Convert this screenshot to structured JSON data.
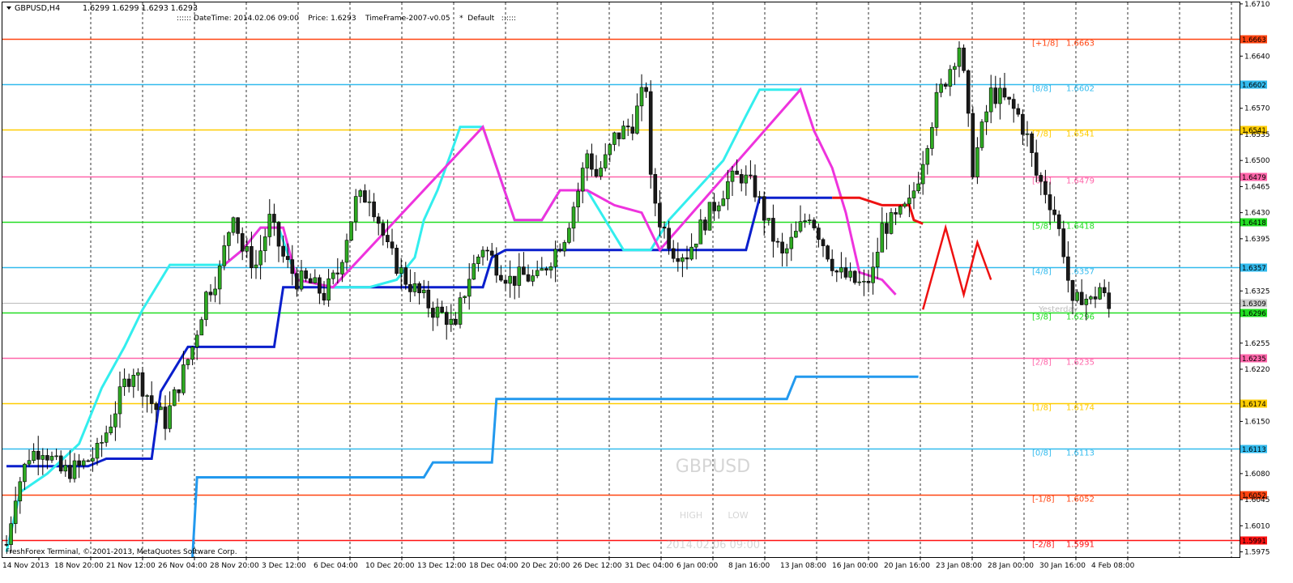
{
  "window": {
    "symbol_tf": "GBPUSD,H4",
    "ohlc": "1.6299 1.6299 1.6293 1.6293"
  },
  "info_bar": ":::::: DateTime: 2014.02.06 09:00    Price: 1.6293    TimeFrame-2007-v0.05    *  Default   ::::::",
  "copyright": "FreshForex Terminal, © 2001-2013, MetaQuotes Software Corp.",
  "watermark": {
    "symbol": "GBPUSD",
    "high_label": "HIGH",
    "low_label": "LOW",
    "datetime": "2014.02.06 09:00"
  },
  "yesterday_label": "Yesterday",
  "colors": {
    "bull": "#2eaa22",
    "bear": "#1a1a1a",
    "cyan_line": "#33eeee",
    "magenta_line": "#ee33dd",
    "darkblue_line": "#0a1fcc",
    "lightblue_line": "#2299ee",
    "red_line": "#ee1111",
    "grid": "#333333"
  },
  "y_axis": {
    "min": 1.5968,
    "max": 1.6712,
    "ticks": [
      "1.6710",
      "1.6640",
      "1.6570",
      "1.6535",
      "1.6500",
      "1.6465",
      "1.6430",
      "1.6395",
      "1.6325",
      "1.6255",
      "1.6220",
      "1.6150",
      "1.6080",
      "1.6045",
      "1.6010",
      "1.5975"
    ]
  },
  "x_axis": {
    "labels": [
      "14 Nov 2013",
      "18 Nov 20:00",
      "21 Nov 12:00",
      "26 Nov 04:00",
      "28 Nov 20:00",
      "3 Dec 12:00",
      "6 Dec 04:00",
      "10 Dec 20:00",
      "13 Dec 12:00",
      "18 Dec 04:00",
      "20 Dec 20:00",
      "26 Dec 12:00",
      "31 Dec 04:00",
      "6 Jan 00:00",
      "8 Jan 16:00",
      "13 Jan 08:00",
      "16 Jan 00:00",
      "20 Jan 16:00",
      "23 Jan 08:00",
      "28 Jan 00:00",
      "30 Jan 16:00",
      "4 Feb 08:00"
    ]
  },
  "murrey_levels": [
    {
      "label": "[+1/8]",
      "value": "1.6663",
      "color": "#ff4411"
    },
    {
      "label": "[8/8]",
      "value": "1.6602",
      "color": "#33bbee"
    },
    {
      "label": "[7/8]",
      "value": "1.6541",
      "color": "#ffcc00"
    },
    {
      "label": "[6/8]",
      "value": "1.6479",
      "color": "#ff66aa"
    },
    {
      "label": "[5/8]",
      "value": "1.6418",
      "color": "#22dd22"
    },
    {
      "label": "[4/8]",
      "value": "1.6357",
      "color": "#33bbee"
    },
    {
      "label": "[3/8]",
      "value": "1.6296",
      "color": "#22dd22"
    },
    {
      "label": "[2/8]",
      "value": "1.6235",
      "color": "#ff66aa"
    },
    {
      "label": "[1/8]",
      "value": "1.6174",
      "color": "#ffcc00"
    },
    {
      "label": "[0/8]",
      "value": "1.6113",
      "color": "#33bbee"
    },
    {
      "label": "[-1/8]",
      "value": "1.6052",
      "color": "#ff4411"
    },
    {
      "label": "[-2/8]",
      "value": "1.5991",
      "color": "#ff1111"
    }
  ],
  "current_price_badge": {
    "value": "1.6309",
    "color": "#cccccc"
  },
  "chart_data": {
    "type": "candlestick",
    "symbol": "GBPUSD",
    "timeframe": "H4",
    "anchors": [
      [
        0,
        1.5985
      ],
      [
        2,
        1.6055
      ],
      [
        5,
        1.6105
      ],
      [
        8,
        1.6115
      ],
      [
        12,
        1.6082
      ],
      [
        16,
        1.6088
      ],
      [
        20,
        1.6108
      ],
      [
        23,
        1.615
      ],
      [
        26,
        1.62
      ],
      [
        28,
        1.622
      ],
      [
        32,
        1.6175
      ],
      [
        35,
        1.615
      ],
      [
        38,
        1.62
      ],
      [
        41,
        1.625
      ],
      [
        44,
        1.632
      ],
      [
        47,
        1.6352
      ],
      [
        50,
        1.6435
      ],
      [
        52,
        1.638
      ],
      [
        55,
        1.636
      ],
      [
        58,
        1.642
      ],
      [
        61,
        1.637
      ],
      [
        64,
        1.634
      ],
      [
        67,
        1.6335
      ],
      [
        70,
        1.632
      ],
      [
        73,
        1.635
      ],
      [
        75,
        1.64
      ],
      [
        77,
        1.6445
      ],
      [
        80,
        1.6455
      ],
      [
        82,
        1.642
      ],
      [
        84,
        1.638
      ],
      [
        88,
        1.634
      ],
      [
        91,
        1.632
      ],
      [
        94,
        1.63
      ],
      [
        97,
        1.629
      ],
      [
        99,
        1.627
      ],
      [
        100,
        1.6305
      ],
      [
        102,
        1.6345
      ],
      [
        105,
        1.6385
      ],
      [
        108,
        1.636
      ],
      [
        111,
        1.634
      ],
      [
        114,
        1.6345
      ],
      [
        117,
        1.634
      ],
      [
        120,
        1.637
      ],
      [
        123,
        1.64
      ],
      [
        126,
        1.646
      ],
      [
        128,
        1.651
      ],
      [
        130,
        1.648
      ],
      [
        132,
        1.65
      ],
      [
        134,
        1.653
      ],
      [
        136,
        1.654
      ],
      [
        138,
        1.655
      ],
      [
        140,
        1.6585
      ],
      [
        141,
        1.66
      ],
      [
        142,
        1.647
      ],
      [
        144,
        1.642
      ],
      [
        147,
        1.638
      ],
      [
        150,
        1.6375
      ],
      [
        153,
        1.641
      ],
      [
        156,
        1.644
      ],
      [
        159,
        1.647
      ],
      [
        162,
        1.648
      ],
      [
        165,
        1.646
      ],
      [
        168,
        1.641
      ],
      [
        171,
        1.637
      ],
      [
        174,
        1.64
      ],
      [
        177,
        1.643
      ],
      [
        180,
        1.639
      ],
      [
        183,
        1.635
      ],
      [
        186,
        1.634
      ],
      [
        189,
        1.633
      ],
      [
        191,
        1.635
      ],
      [
        193,
        1.641
      ],
      [
        196,
        1.642
      ],
      [
        199,
        1.644
      ],
      [
        201,
        1.648
      ],
      [
        203,
        1.653
      ],
      [
        205,
        1.658
      ],
      [
        207,
        1.661
      ],
      [
        209,
        1.664
      ],
      [
        210,
        1.6655
      ],
      [
        211,
        1.661
      ],
      [
        213,
        1.649
      ],
      [
        215,
        1.654
      ],
      [
        217,
        1.659
      ],
      [
        219,
        1.6585
      ],
      [
        221,
        1.6575
      ],
      [
        223,
        1.656
      ],
      [
        225,
        1.653
      ],
      [
        227,
        1.648
      ],
      [
        229,
        1.646
      ],
      [
        231,
        1.643
      ],
      [
        233,
        1.638
      ],
      [
        235,
        1.63
      ],
      [
        237,
        1.632
      ],
      [
        239,
        1.631
      ],
      [
        241,
        1.633
      ],
      [
        243,
        1.63
      ],
      [
        244,
        1.6295
      ]
    ],
    "n_candles": 245,
    "cyan_line": [
      [
        0,
        1.5975
      ],
      [
        3,
        1.6055
      ],
      [
        9,
        1.608
      ],
      [
        16,
        1.612
      ],
      [
        21,
        1.6195
      ],
      [
        26,
        1.625
      ],
      [
        30,
        1.63
      ],
      [
        36,
        1.636
      ],
      [
        48,
        1.636
      ],
      [
        52,
        1.638
      ],
      [
        56,
        1.641
      ],
      [
        60,
        1.641
      ],
      [
        64,
        1.634
      ],
      [
        72,
        1.633
      ],
      [
        80,
        1.633
      ],
      [
        86,
        1.634
      ],
      [
        90,
        1.637
      ],
      [
        92,
        1.642
      ],
      [
        95,
        1.646
      ],
      [
        98,
        1.651
      ],
      [
        100,
        1.6545
      ],
      [
        105,
        1.6545
      ],
      [
        112,
        1.642
      ],
      [
        118,
        1.642
      ],
      [
        122,
        1.646
      ],
      [
        128,
        1.646
      ],
      [
        136,
        1.638
      ],
      [
        142,
        1.638
      ],
      [
        146,
        1.642
      ],
      [
        152,
        1.646
      ],
      [
        158,
        1.65
      ],
      [
        163,
        1.656
      ],
      [
        166,
        1.6595
      ],
      [
        175,
        1.6595
      ]
    ],
    "magenta_line": [
      [
        48,
        1.636
      ],
      [
        52,
        1.638
      ],
      [
        56,
        1.641
      ],
      [
        61,
        1.641
      ],
      [
        64,
        1.634
      ],
      [
        72,
        1.633
      ],
      [
        105,
        1.6545
      ],
      [
        112,
        1.642
      ],
      [
        118,
        1.642
      ],
      [
        122,
        1.646
      ],
      [
        128,
        1.646
      ],
      [
        134,
        1.644
      ],
      [
        140,
        1.643
      ],
      [
        144,
        1.638
      ],
      [
        175,
        1.6595
      ],
      [
        178,
        1.654
      ],
      [
        182,
        1.649
      ],
      [
        185,
        1.643
      ],
      [
        188,
        1.635
      ],
      [
        193,
        1.634
      ],
      [
        196,
        1.632
      ]
    ],
    "darkblue_line": [
      [
        0,
        1.609
      ],
      [
        18,
        1.609
      ],
      [
        22,
        1.61
      ],
      [
        32,
        1.61
      ],
      [
        34,
        1.619
      ],
      [
        38,
        1.623
      ],
      [
        40,
        1.625
      ],
      [
        59,
        1.625
      ],
      [
        61,
        1.633
      ],
      [
        105,
        1.633
      ],
      [
        107,
        1.637
      ],
      [
        110,
        1.638
      ],
      [
        163,
        1.638
      ],
      [
        166,
        1.645
      ],
      [
        182,
        1.645
      ]
    ],
    "lightblue_line": [
      [
        41,
        1.5968
      ],
      [
        42,
        1.6075
      ],
      [
        92,
        1.6075
      ],
      [
        94,
        1.6095
      ],
      [
        107,
        1.6095
      ],
      [
        108,
        1.618
      ],
      [
        172,
        1.618
      ],
      [
        174,
        1.621
      ],
      [
        201,
        1.621
      ]
    ],
    "red_line": [
      [
        182,
        1.645
      ],
      [
        188,
        1.645
      ],
      [
        193,
        1.644
      ],
      [
        199,
        1.644
      ],
      [
        200,
        1.642
      ],
      [
        202,
        1.6415
      ]
    ],
    "red_projection": [
      [
        202,
        1.63
      ],
      [
        207,
        1.641
      ],
      [
        211,
        1.632
      ],
      [
        214,
        1.639
      ],
      [
        217,
        1.634
      ]
    ]
  }
}
